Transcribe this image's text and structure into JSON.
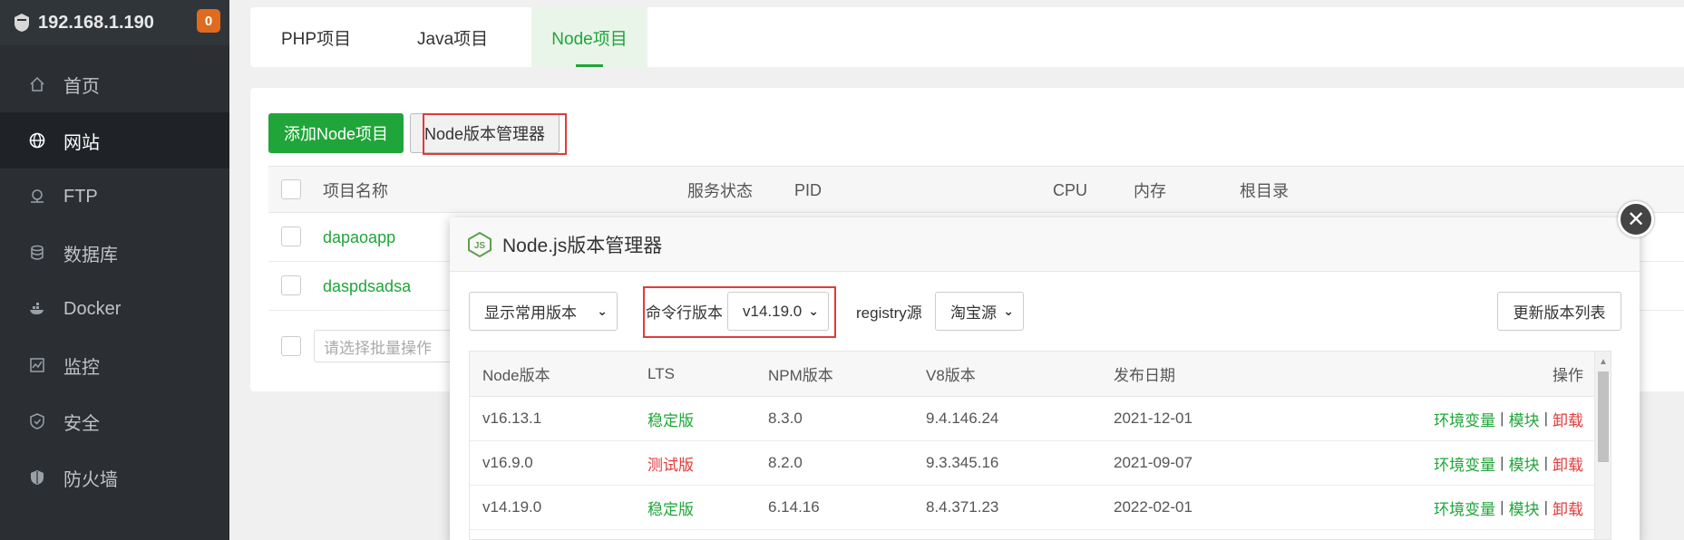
{
  "sidebar": {
    "server_ip": "192.168.1.190",
    "badge_count": "0",
    "items": [
      {
        "label": "首页",
        "icon": "home-icon"
      },
      {
        "label": "网站",
        "icon": "globe-icon"
      },
      {
        "label": "FTP",
        "icon": "ftp-icon"
      },
      {
        "label": "数据库",
        "icon": "database-icon"
      },
      {
        "label": "Docker",
        "icon": "docker-icon"
      },
      {
        "label": "监控",
        "icon": "monitor-icon"
      },
      {
        "label": "安全",
        "icon": "shield-icon"
      },
      {
        "label": "防火墙",
        "icon": "firewall-icon"
      }
    ],
    "active_item": "网站"
  },
  "tabs": [
    {
      "label": "PHP项目"
    },
    {
      "label": "Java项目"
    },
    {
      "label": "Node项目"
    }
  ],
  "active_tab": "Node项目",
  "toolbar": {
    "add_label": "添加Node项目",
    "version_manager_label": "Node版本管理器"
  },
  "project_table": {
    "headers": [
      "项目名称",
      "服务状态",
      "PID",
      "CPU",
      "内存",
      "根目录"
    ],
    "rows": [
      {
        "name": "dapaoapp"
      },
      {
        "name": "daspdsadsa"
      }
    ],
    "batch_placeholder": "请选择批量操作"
  },
  "modal": {
    "title": "Node.js版本管理器",
    "filter_select": "显示常用版本",
    "cli_version_label": "命令行版本",
    "cli_version_value": "v14.19.0",
    "registry_label": "registry源",
    "registry_value": "淘宝源",
    "update_button": "更新版本列表",
    "close_icon": "close-icon",
    "table": {
      "headers": [
        "Node版本",
        "LTS",
        "NPM版本",
        "V8版本",
        "发布日期",
        "操作"
      ],
      "rows": [
        {
          "node": "v16.13.1",
          "lts": "稳定版",
          "lts_type": "stable",
          "npm": "8.3.0",
          "v8": "9.4.146.24",
          "date": "2021-12-01"
        },
        {
          "node": "v16.9.0",
          "lts": "测试版",
          "lts_type": "beta",
          "npm": "8.2.0",
          "v8": "9.3.345.16",
          "date": "2021-09-07"
        },
        {
          "node": "v14.19.0",
          "lts": "稳定版",
          "lts_type": "stable",
          "npm": "6.14.16",
          "v8": "8.4.371.23",
          "date": "2022-02-01"
        }
      ],
      "ops": {
        "env": "环境变量",
        "module": "模块",
        "uninstall": "卸载",
        "sep": "|"
      }
    }
  },
  "colors": {
    "accent_green": "#20a53a",
    "danger_red": "#e03b3b",
    "sidebar_bg": "#2b2f33",
    "badge_orange": "#e06b1f"
  }
}
